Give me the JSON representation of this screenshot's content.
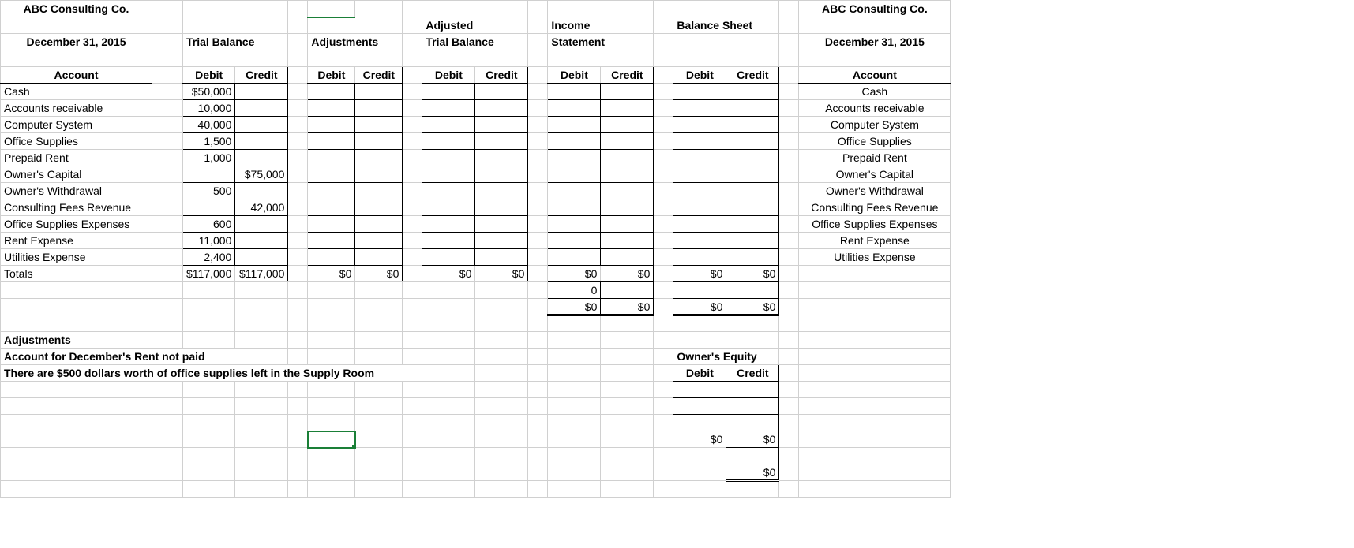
{
  "company": "ABC Consulting Co.",
  "date": "December 31, 2015",
  "sections": {
    "trial_balance": "Trial Balance",
    "adjustments": "Adjustments",
    "adjusted_tb": "Adjusted\nTrial Balance",
    "adjusted_tb_l1": "Adjusted",
    "adjusted_tb_l2": "Trial Balance",
    "income": "Income\nStatement",
    "income_l1": "Income",
    "income_l2": "Statement",
    "balance": "Balance Sheet",
    "owners_equity": "Owner's Equity"
  },
  "headers": {
    "account": "Account",
    "debit": "Debit",
    "credit": "Credit"
  },
  "accounts": [
    {
      "name": "Cash",
      "debit": "$50,000",
      "credit": ""
    },
    {
      "name": "Accounts receivable",
      "debit": "10,000",
      "credit": ""
    },
    {
      "name": "Computer System",
      "debit": "40,000",
      "credit": ""
    },
    {
      "name": "Office Supplies",
      "debit": "1,500",
      "credit": ""
    },
    {
      "name": "Prepaid Rent",
      "debit": "1,000",
      "credit": ""
    },
    {
      "name": "Owner's Capital",
      "debit": "",
      "credit": "$75,000"
    },
    {
      "name": "Owner's Withdrawal",
      "debit": "500",
      "credit": ""
    },
    {
      "name": "Consulting Fees Revenue",
      "debit": "",
      "credit": "42,000"
    },
    {
      "name": "Office Supplies Expenses",
      "debit": "600",
      "credit": ""
    },
    {
      "name": "Rent Expense",
      "debit": "11,000",
      "credit": ""
    },
    {
      "name": "Utilities Expense",
      "debit": "2,400",
      "credit": ""
    }
  ],
  "totals": {
    "label": "Totals",
    "tb_debit": "$117,000",
    "tb_credit": "$117,000",
    "adj_debit": "$0",
    "adj_credit": "$0",
    "adjtb_debit": "$0",
    "adjtb_credit": "$0",
    "is_debit": "$0",
    "is_credit": "$0",
    "bs_debit": "$0",
    "bs_credit": "$0",
    "is_extra": "0",
    "is_final_debit": "$0",
    "is_final_credit": "$0",
    "bs_final_debit": "$0",
    "bs_final_credit": "$0",
    "oe_debit": "$0",
    "oe_credit": "$0",
    "oe_final": "$0"
  },
  "notes": {
    "heading": "Adjustments",
    "line1": "Account for December's Rent not paid",
    "line2": "There are $500 dollars worth of office supplies left in the Supply Room"
  }
}
